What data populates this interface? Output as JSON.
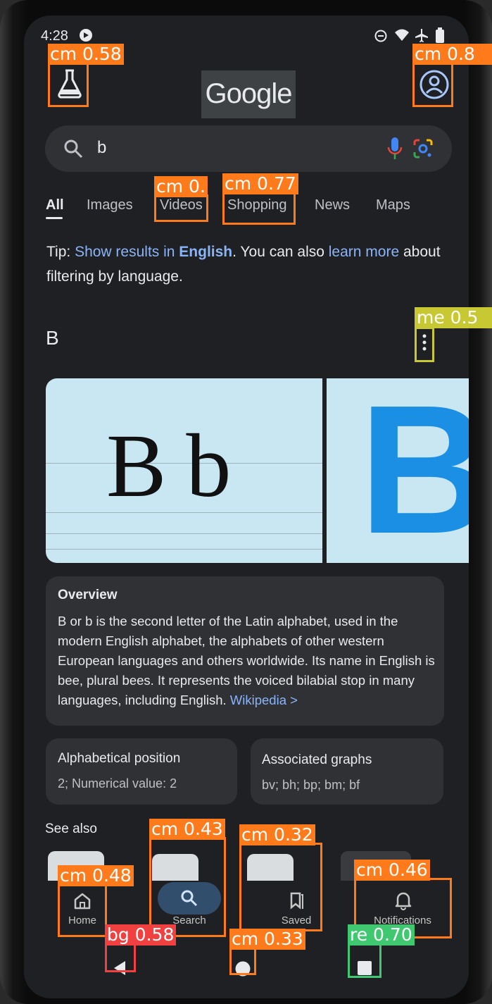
{
  "status_bar": {
    "time": "4:28"
  },
  "header": {
    "logo_text": "Google"
  },
  "search": {
    "query": "b"
  },
  "tabs": [
    {
      "label": "All"
    },
    {
      "label": "Images"
    },
    {
      "label": "Videos"
    },
    {
      "label": "Shopping"
    },
    {
      "label": "News"
    },
    {
      "label": "Maps"
    }
  ],
  "tip": {
    "prefix": "Tip: ",
    "show_link": "Show results in ",
    "language_link": "English",
    "middle": ". You can also ",
    "learn_link": "learn more",
    "suffix": " about filtering by language."
  },
  "knowledge_panel": {
    "title": "B",
    "image_text": "B b",
    "image2_text": "B",
    "overview_title": "Overview",
    "overview_text": "B or b is the second letter of the Latin alphabet, used in the modern English alphabet, the alphabets of other western European languages and others worldwide. Its name in English is bee, plural bees. It represents the voiced bilabial stop in many languages, including English. ",
    "overview_source": "Wikipedia >",
    "facts": [
      {
        "title": "Alphabetical position",
        "value": "2; Numerical value: 2"
      },
      {
        "title": "Associated graphs",
        "value": "bv; bh; bp; bm; bf"
      }
    ],
    "see_also": "See also"
  },
  "bottom_nav": [
    {
      "label": "Home"
    },
    {
      "label": "Search"
    },
    {
      "label": "Saved"
    },
    {
      "label": "Notifications"
    }
  ],
  "detections": [
    {
      "label": "cm 0.58",
      "color": "#ff7a1a"
    },
    {
      "label": "cm 0.8",
      "color": "#ff7a1a"
    },
    {
      "label": "cm 0.",
      "color": "#ff7a1a"
    },
    {
      "label": "cm 0.77",
      "color": "#ff7a1a"
    },
    {
      "label": "me 0.5",
      "color": "#c8c832"
    },
    {
      "label": "cm 0.43",
      "color": "#ff7a1a"
    },
    {
      "label": "cm 0.32",
      "color": "#ff7a1a"
    },
    {
      "label": "cm 0.48",
      "color": "#ff7a1a"
    },
    {
      "label": "cm 0.46",
      "color": "#ff7a1a"
    },
    {
      "label": "bg 0.58",
      "color": "#f04040"
    },
    {
      "label": "cm 0.33",
      "color": "#ff7a1a"
    },
    {
      "label": "re 0.70",
      "color": "#40c870"
    }
  ]
}
